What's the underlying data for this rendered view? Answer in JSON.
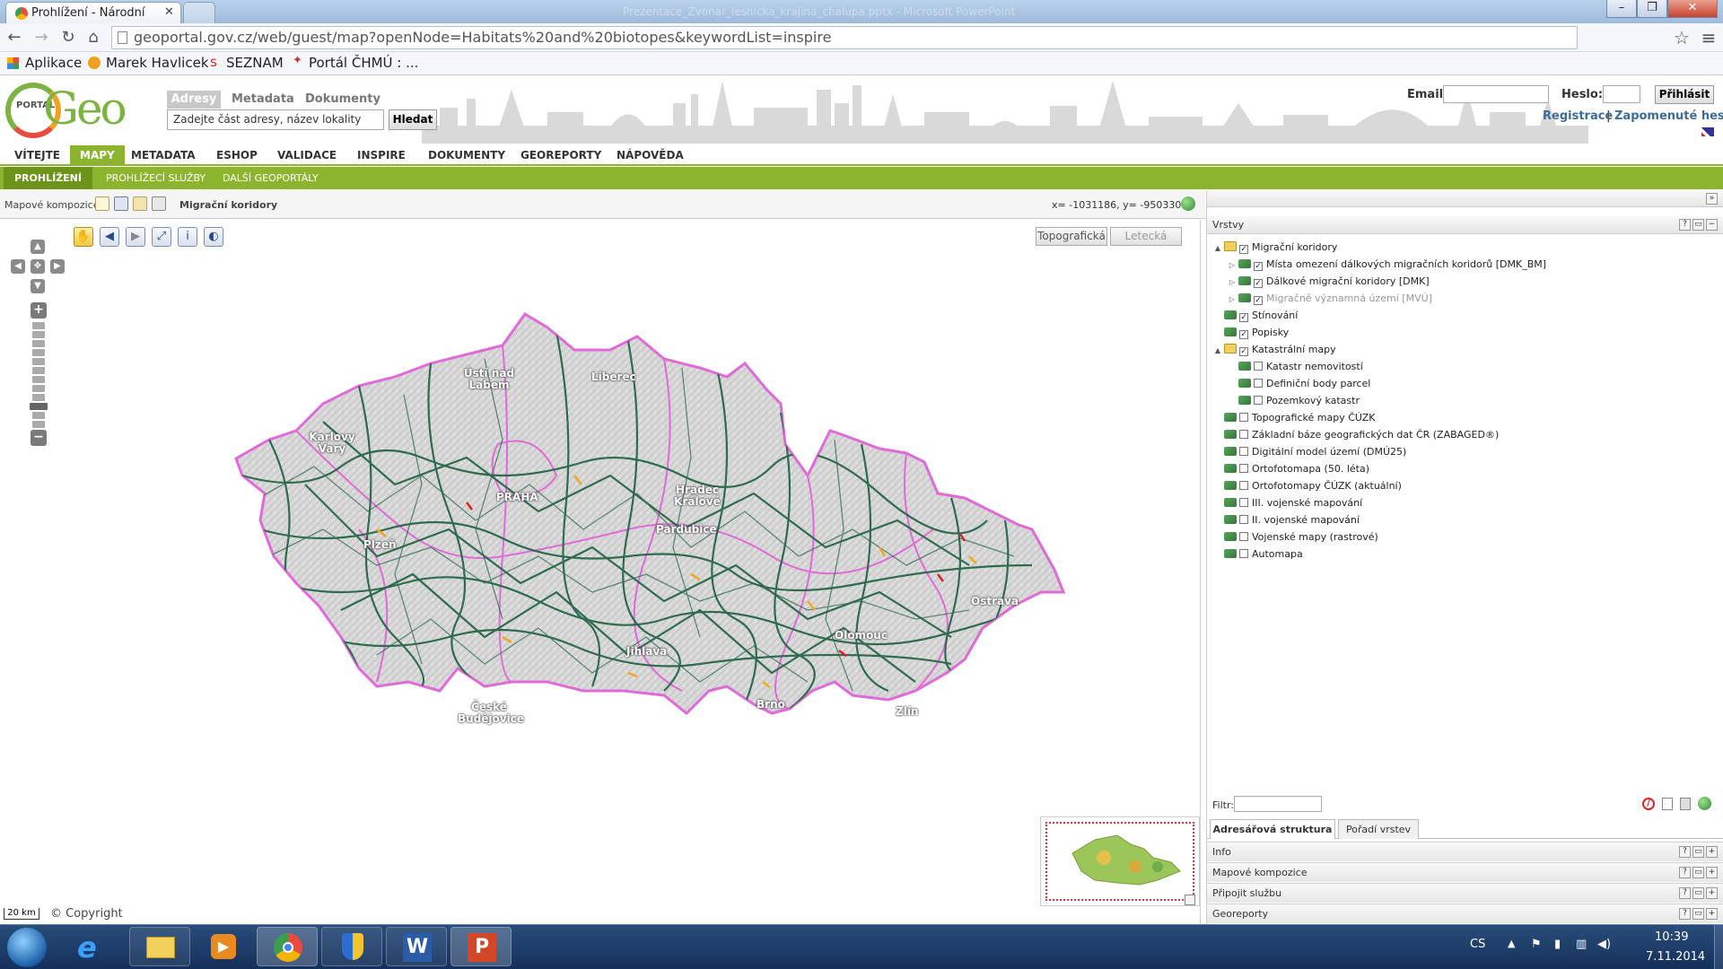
{
  "browser": {
    "tab_title": "Prohlížení - Národní",
    "ghost_window_title": "Prezentace_Zvonar_lesnicka_krajina_chalupa.pptx - Microsoft PowerPoint",
    "url": "geoportal.gov.cz/web/guest/map?openNode=Habitats%20and%20biotopes&keywordList=inspire",
    "bookmarks": [
      "Aplikace",
      "Marek Havlicek",
      "SEZNAM",
      "Portál ČHMÚ : ..."
    ],
    "window_buttons": [
      "–",
      "❐",
      "✕"
    ]
  },
  "header": {
    "logo_small": "PORTAL",
    "logo_big": "Geo",
    "search_tabs": [
      "Adresy",
      "Metadata",
      "Dokumenty"
    ],
    "search_placeholder": "Zadejte část adresy, název lokality",
    "search_button": "Hledat",
    "email_label": "Email:",
    "password_label": "Heslo:",
    "login_button": "Přihlásit",
    "register_link": "Registrace",
    "separator": "|",
    "forgot_link": "Zapomenuté heslo"
  },
  "main_menu": [
    "VÍTEJTE",
    "MAPY",
    "METADATA",
    "ESHOP",
    "VALIDACE",
    "INSPIRE",
    "DOKUMENTY",
    "GEOREPORTY",
    "NÁPOVĚDA"
  ],
  "sub_menu": [
    "PROHLÍŽENÍ",
    "PROHLÍŽECÍ SLUŽBY",
    "DALŠÍ GEOPORTÁLY"
  ],
  "map_toolbar": {
    "label": "Mapové kompozice:",
    "composition_name": "Migrační koridory",
    "coordinates": "x= -1031186, y= -950330"
  },
  "map": {
    "basemaps": [
      "Topografická",
      "Letecká"
    ],
    "city_labels": [
      "Ústí nad Labem",
      "Liberec",
      "Karlovy Vary",
      "PRAHA",
      "Hradec Králové",
      "Pardubice",
      "Plzeň",
      "Ostrava",
      "Olomouc",
      "Jihlava",
      "Brno",
      "Zlín",
      "České Budějovice"
    ],
    "scale": "20 km",
    "copyright": "© Copyright",
    "zoom_plus": "+",
    "zoom_minus": "−"
  },
  "colors": {
    "accent_green": "#8db42f",
    "corridor_green": "#2e6b4f",
    "region_border": "#e06ad8",
    "link_blue": "#3d6c9b"
  },
  "panel": {
    "layers_title": "Vrstvy",
    "layers": [
      {
        "label": "Migrační koridory",
        "checked": true,
        "level": 0,
        "folder": true,
        "expanded": true
      },
      {
        "label": "Místa omezení dálkových migračních koridorů [DMK_BM]",
        "checked": true,
        "level": 1
      },
      {
        "label": "Dálkové migrační koridory [DMK]",
        "checked": true,
        "level": 1
      },
      {
        "label": "Migračně významná území [MVÚ]",
        "checked": true,
        "level": 1,
        "dim": true
      },
      {
        "label": "Stínování",
        "checked": true,
        "level": 0
      },
      {
        "label": "Popisky",
        "checked": true,
        "level": 0
      },
      {
        "label": "Katastrální mapy",
        "checked": true,
        "level": 0,
        "folder": true,
        "expanded": true
      },
      {
        "label": "Katastr nemovitostí",
        "checked": false,
        "level": 1
      },
      {
        "label": "Definiční body parcel",
        "checked": false,
        "level": 1
      },
      {
        "label": "Pozemkový katastr",
        "checked": false,
        "level": 1
      },
      {
        "label": "Topografické mapy ČÚZK",
        "checked": false,
        "level": 0
      },
      {
        "label": "Základní báze geografických dat ČR (ZABAGED®)",
        "checked": false,
        "level": 0
      },
      {
        "label": "Digitální model území (DMÚ25)",
        "checked": false,
        "level": 0
      },
      {
        "label": "Ortofotomapa (50. léta)",
        "checked": false,
        "level": 0
      },
      {
        "label": "Ortofotomapy ČÚZK (aktuální)",
        "checked": false,
        "level": 0
      },
      {
        "label": "III. vojenské mapování",
        "checked": false,
        "level": 0
      },
      {
        "label": "II. vojenské mapování",
        "checked": false,
        "level": 0
      },
      {
        "label": "Vojenské mapy (rastrové)",
        "checked": false,
        "level": 0
      },
      {
        "label": "Automapa",
        "checked": false,
        "level": 0
      }
    ],
    "filter_label": "Filtr:",
    "tabs": [
      "Adresářová struktura",
      "Pořadí vrstev"
    ],
    "accordions": [
      "Info",
      "Mapové kompozice",
      "Připojit službu",
      "Georeporty"
    ],
    "head_buttons": [
      "?",
      "▭",
      "−"
    ]
  },
  "taskbar": {
    "language": "CS",
    "time": "10:39",
    "date": "7.11.2014"
  }
}
